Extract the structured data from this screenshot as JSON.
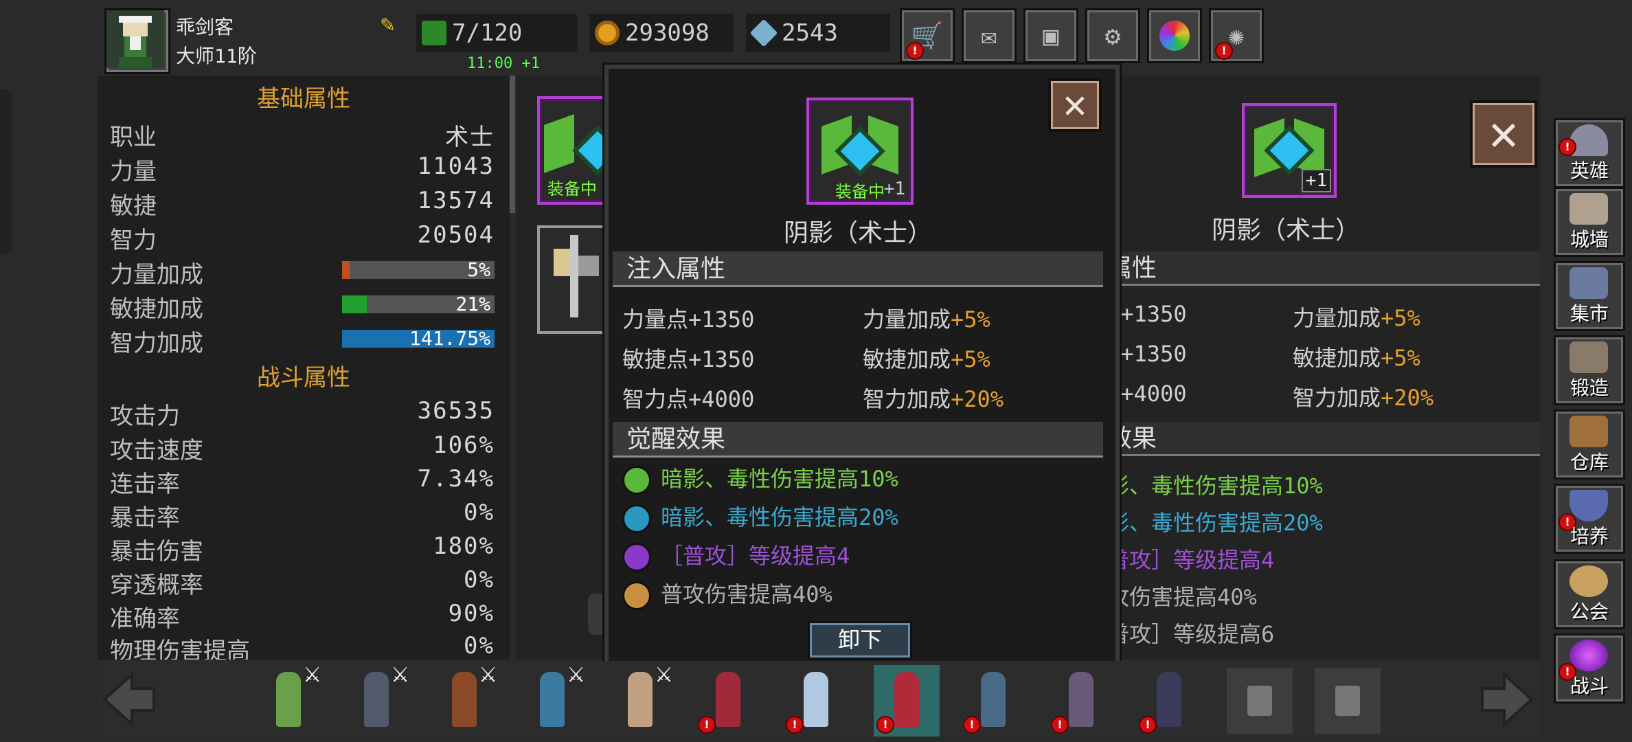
{
  "player": {
    "name": "乖剑客",
    "rank": "大师11阶"
  },
  "resources": {
    "energy": "7/120",
    "energy_timer": "11:00 +1",
    "gold": "293098",
    "diamond": "2543"
  },
  "top_buttons": [
    "cart-icon",
    "mail-icon",
    "gamepad-icon",
    "gear-icon",
    "color-wheel-icon",
    "sparkle-icon"
  ],
  "base_attrs": {
    "title": "基础属性",
    "rows": [
      {
        "k": "职业",
        "v": "术士"
      },
      {
        "k": "力量",
        "v": "11043"
      },
      {
        "k": "敏捷",
        "v": "13574"
      },
      {
        "k": "智力",
        "v": "20504"
      }
    ],
    "bars": [
      {
        "k": "力量加成",
        "v": "5%",
        "pct": 0.05,
        "color": "#c05020"
      },
      {
        "k": "敏捷加成",
        "v": "21%",
        "pct": 0.16,
        "color": "#22a030"
      },
      {
        "k": "智力加成",
        "v": "141.75%",
        "pct": 1.0,
        "color": "#1a70b0"
      }
    ]
  },
  "combat_attrs": {
    "title": "战斗属性",
    "rows": [
      {
        "k": "攻击力",
        "v": "36535"
      },
      {
        "k": "攻击速度",
        "v": "106%"
      },
      {
        "k": "连击率",
        "v": "7.34%"
      },
      {
        "k": "暴击率",
        "v": "0%"
      },
      {
        "k": "暴击伤害",
        "v": "180%"
      },
      {
        "k": "穿透概率",
        "v": "0%"
      },
      {
        "k": "准确率",
        "v": "90%"
      },
      {
        "k": "物理伤害提高",
        "v": "0%"
      }
    ]
  },
  "popup": {
    "equipped_label": "装备中",
    "plus": "+1",
    "item_name": "阴影（术士）",
    "infuse_title": "注入属性",
    "infuse": [
      [
        "力量点+1350",
        "力量加成",
        "+5%"
      ],
      [
        "敏捷点+1350",
        "敏捷加成",
        "+5%"
      ],
      [
        "智力点+4000",
        "智力加成",
        "+20%"
      ]
    ],
    "awaken_title": "觉醒效果",
    "awaken": [
      {
        "text": "暗影、毒性伤害提高10%",
        "color": "#7ad04a",
        "dot": "#5ab83a"
      },
      {
        "text": "暗影、毒性伤害提高20%",
        "color": "#3aa8d0",
        "dot": "#2a98c0"
      },
      {
        "text": "［普攻］等级提高4",
        "color": "#a050d8",
        "dot": "#8a3ac8"
      },
      {
        "text": "普攻伤害提高40%",
        "color": "#b0b0b0",
        "dot": "#c89040"
      }
    ],
    "unequip": "卸下"
  },
  "left_item": {
    "equipped_label": "装备中"
  },
  "compare": {
    "plus": "+1",
    "item_name": "阴影（术士）",
    "infuse_title": "属性",
    "infuse": [
      [
        "{+1350",
        "力量加成",
        "+5%"
      ],
      [
        "{+1350",
        "敏捷加成",
        "+5%"
      ],
      [
        "{+4000",
        "智力加成",
        "+20%"
      ]
    ],
    "awaken_title": "效果",
    "awaken": [
      {
        "text": "影、毒性伤害提高10%",
        "color": "#7ad04a"
      },
      {
        "text": "影、毒性伤害提高20%",
        "color": "#3aa8d0"
      },
      {
        "text": "普攻］等级提高4",
        "color": "#a050d8"
      },
      {
        "text": "攻伤害提高40%",
        "color": "#b0b0b0"
      },
      {
        "text": "普攻］等级提高6",
        "color": "#b0b0b0"
      }
    ]
  },
  "sidebar": [
    {
      "label": "英雄",
      "icon": "helmet-icon",
      "alert": true
    },
    {
      "label": "城墙",
      "icon": "wall-icon",
      "alert": false
    },
    {
      "label": "集市",
      "icon": "market-icon",
      "alert": false
    },
    {
      "label": "锻造",
      "icon": "anvil-icon",
      "alert": false
    },
    {
      "label": "仓库",
      "icon": "chest-icon",
      "alert": false
    },
    {
      "label": "培养",
      "icon": "trophy-icon",
      "alert": true
    },
    {
      "label": "公会",
      "icon": "lion-icon",
      "alert": false
    },
    {
      "label": "战斗",
      "icon": "portal-icon",
      "alert": true
    }
  ]
}
